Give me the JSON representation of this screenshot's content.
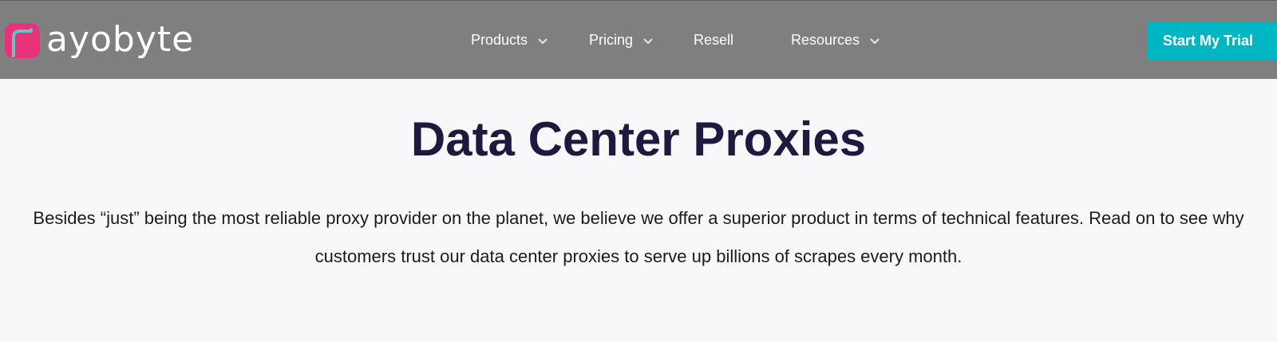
{
  "header": {
    "brand": "ayobyte",
    "nav": [
      {
        "label": "Products",
        "has_dropdown": true
      },
      {
        "label": "Pricing",
        "has_dropdown": true
      },
      {
        "label": "Resell",
        "has_dropdown": false
      },
      {
        "label": "Resources",
        "has_dropdown": true
      }
    ],
    "cta_label": "Start My Trial"
  },
  "main": {
    "title": "Data Center Proxies",
    "description": "Besides “just” being the most reliable proxy provider on the planet, we believe we offer a superior product in terms of technical features. Read on to see why customers trust our data center proxies to serve up billions of scrapes every month."
  },
  "colors": {
    "header_bg": "#7f7f7f",
    "accent": "#00b6c2",
    "logo_pink": "#e8337a",
    "title": "#1f1a3d",
    "page_bg": "#f8f8fa"
  },
  "icons": [
    "rayobyte-logo-mark",
    "chevron-down-icon"
  ]
}
